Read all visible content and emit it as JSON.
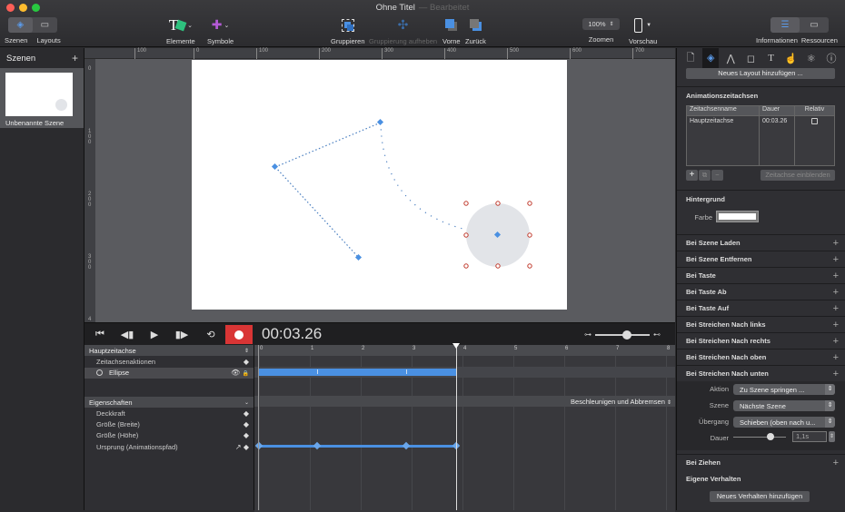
{
  "window": {
    "title": "Ohne Titel",
    "subtitle": "— Bearbeitet"
  },
  "toolbar": {
    "scenes": "Szenen",
    "layouts": "Layouts",
    "elements": "Elemente",
    "symbols": "Symbole",
    "group": "Gruppieren",
    "ungroup": "Gruppierung aufheben",
    "front": "Vorne",
    "back": "Zurück",
    "zoom_value": "100%",
    "zoom_label": "Zoomen",
    "preview": "Vorschau",
    "info": "Informationen",
    "resources": "Ressourcen"
  },
  "scenes_panel": {
    "title": "Szenen",
    "add": "+",
    "scene_name": "Unbenannte Szene"
  },
  "rulers": {
    "horizontal": [
      "100",
      "0",
      "100",
      "200",
      "300",
      "400",
      "500",
      "600",
      "700"
    ],
    "vertical": [
      "0",
      "100",
      "200",
      "300",
      "4"
    ]
  },
  "transport": {
    "time": "00:03.26"
  },
  "timeline": {
    "main_timeline": "Hauptzeitachse",
    "actions": "Zeitachsenaktionen",
    "element": "Ellipse",
    "properties_header": "Eigenschaften",
    "easing": "Beschleunigen und Abbremsen",
    "properties": [
      "Deckkraft",
      "Größe (Breite)",
      "Größe (Höhe)",
      "Ursprung (Animationspfad)"
    ],
    "ticks": [
      "0",
      "1",
      "2",
      "3",
      "4",
      "5",
      "6",
      "7",
      "8"
    ],
    "playhead_seconds": 3.87,
    "element_bar": {
      "start": 0,
      "end": 3.87
    },
    "keyframes_seconds": [
      0,
      1.15,
      2.9,
      3.87
    ]
  },
  "inspector": {
    "tabs": [
      "document-icon",
      "layers-icon",
      "metrics-icon",
      "shapes-icon",
      "text-icon",
      "hand-icon",
      "atom-icon",
      "info-icon"
    ],
    "new_layout": "Neues Layout hinzufügen ...",
    "anim_timelines_title": "Animationszeitachsen",
    "table_headers": [
      "Zeitachsenname",
      "Dauer",
      "Relativ"
    ],
    "table_rows": [
      {
        "name": "Hauptzeitachse",
        "duration": "00:03.26",
        "relative": false
      }
    ],
    "show_timeline": "Zeitachse einblenden",
    "background_title": "Hintergrund",
    "color_label": "Farbe",
    "color_value": "#ffffff",
    "events": [
      "Bei Szene Laden",
      "Bei Szene Entfernen",
      "Bei Taste",
      "Bei Taste Ab",
      "Bei Taste Auf",
      "Bei Streichen Nach links",
      "Bei Streichen Nach rechts",
      "Bei Streichen Nach oben",
      "Bei Streichen Nach unten"
    ],
    "action_label": "Aktion",
    "action_value": "Zu Szene springen ...",
    "scene_label": "Szene",
    "scene_value": "Nächste Szene",
    "transition_label": "Übergang",
    "transition_value": "Schieben (oben nach u...",
    "duration_label": "Dauer",
    "duration_value": "1,1s",
    "duration_slider": 0.7,
    "drag_event": "Bei Ziehen",
    "custom_behaviors": "Eigene Verhalten",
    "new_behavior": "Neues Verhalten hinzufügen"
  },
  "colors": {
    "accent": "#4a90e2",
    "record": "#d93535",
    "handle": "#c0392b"
  }
}
